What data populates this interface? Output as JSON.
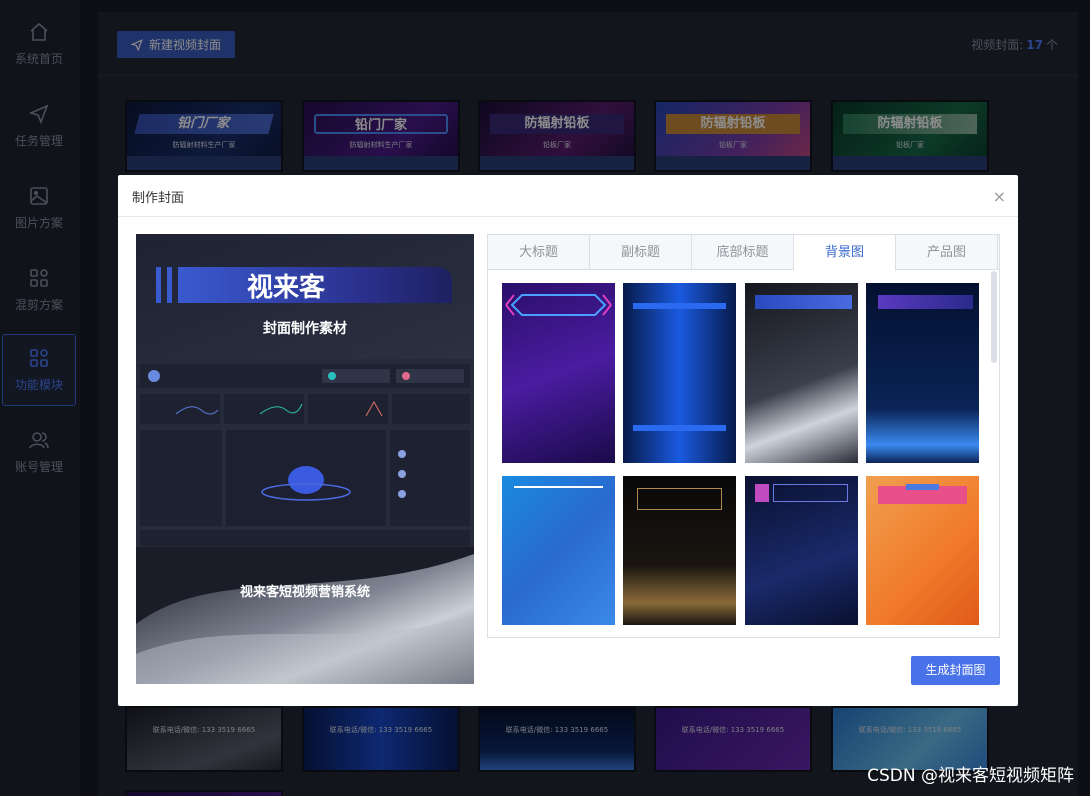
{
  "sidebar": {
    "items": [
      {
        "label": "系统首页",
        "icon": "home-icon"
      },
      {
        "label": "任务管理",
        "icon": "send-icon"
      },
      {
        "label": "图片方案",
        "icon": "image-icon"
      },
      {
        "label": "混剪方案",
        "icon": "mix-icon"
      },
      {
        "label": "功能模块",
        "icon": "grid-icon",
        "active": true
      },
      {
        "label": "账号管理",
        "icon": "users-icon"
      }
    ]
  },
  "header": {
    "new_button": "新建视频封面",
    "count_label": "视频封面:",
    "count_value": "17",
    "count_unit": "个"
  },
  "covers": [
    {
      "title": "铅门厂家",
      "subtitle": "防辐射材料生产厂家"
    },
    {
      "title": "铅门厂家",
      "subtitle": "防辐射材料生产厂家"
    },
    {
      "title": "防辐射铅板",
      "subtitle": "铅板厂家"
    },
    {
      "title": "防辐射铅板",
      "subtitle": "铅板厂家"
    },
    {
      "title": "防辐射铅板",
      "subtitle": "铅板厂家"
    }
  ],
  "bottom_covers": [
    {
      "text": "联系电话/微信: 133 3519 6665"
    },
    {
      "text": "联系电话/微信: 133 3519 6665"
    },
    {
      "text": "联系电话/微信: 133 3519 6665"
    },
    {
      "text": "联系电话/微信: 133 3519 6665"
    },
    {
      "text": "联系电话/微信: 133 3519 6665"
    }
  ],
  "dialog": {
    "title": "制作封面",
    "close": "×",
    "tabs": [
      "大标题",
      "副标题",
      "底部标题",
      "背景图",
      "产品图"
    ],
    "active_tab": "背景图",
    "generate_button": "生成封面图"
  },
  "preview": {
    "title": "视来客",
    "subtitle": "封面制作素材",
    "bottom": "视来客短视频营销系统"
  },
  "watermark": "CSDN @视来客短视频矩阵",
  "colors": {
    "accent": "#4a72e8",
    "sidebar_bg": "#1f2330",
    "page_bg": "#1a1d26"
  }
}
